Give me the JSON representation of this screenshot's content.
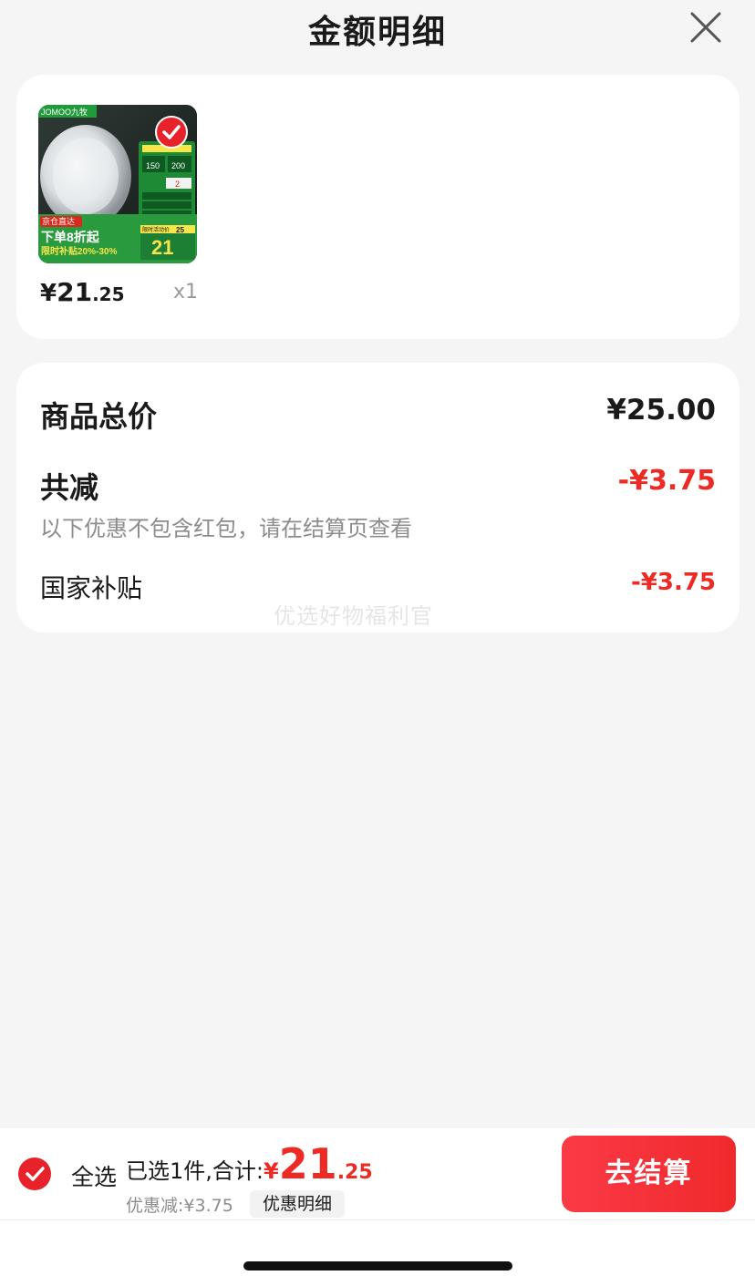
{
  "header": {
    "title": "金额明细"
  },
  "product": {
    "thumbnail": {
      "brand": "JOMOO九牧",
      "tag": "京仓直达",
      "promo_main": "下单8折起",
      "promo_sub": "限时补贴20%-30%",
      "final_price_label": "限时活动价",
      "final_price": "21",
      "side_values": [
        "150",
        "200",
        "2",
        "25"
      ]
    },
    "price_symbol": "¥",
    "price_int": "21",
    "price_dec": ".25",
    "quantity": "x1"
  },
  "summary": {
    "total_label": "商品总价",
    "total_value": "¥25.00",
    "reduce_label": "共减",
    "reduce_value": "-¥3.75",
    "note": "以下优惠不包含红包，请在结算页查看",
    "subsidy_label": "国家补贴",
    "subsidy_value": "-¥3.75",
    "watermark": "优选好物福利官"
  },
  "bottom_bar": {
    "select_all_label": "全选",
    "selected_text": "已选1件,合计:",
    "total_symbol": "¥",
    "total_int": "21",
    "total_dec": ".25",
    "discount_text": "优惠减:¥3.75",
    "detail_chip": "优惠明细",
    "checkout_label": "去结算"
  },
  "colors": {
    "accent_red": "#ee2a24",
    "checkout_gradient_start": "#fb3a47",
    "checkout_gradient_end": "#f0292b",
    "background": "#f5f5f5",
    "card": "#ffffff"
  }
}
